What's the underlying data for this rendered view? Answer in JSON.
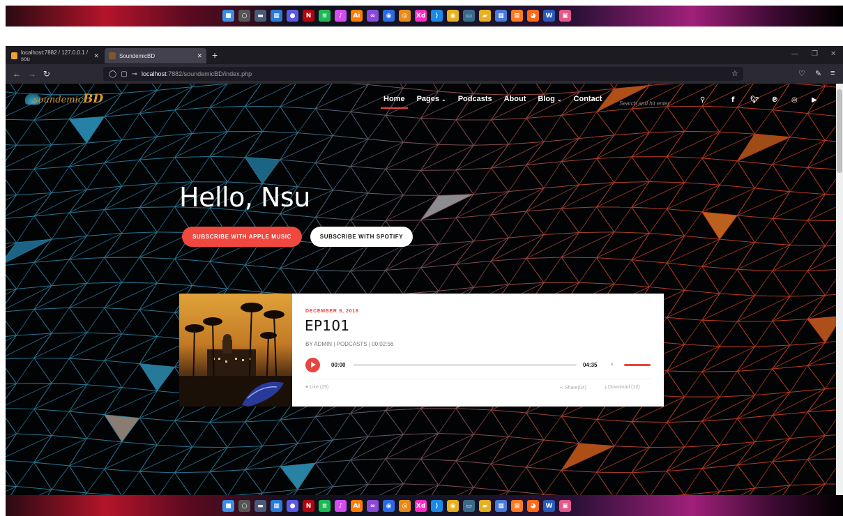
{
  "taskbar": {
    "icons": [
      {
        "name": "windows-start-icon",
        "glyph": "■",
        "color": "#3a8ee6"
      },
      {
        "name": "search-icon",
        "glyph": "○",
        "color": "#555555"
      },
      {
        "name": "task-view-icon",
        "glyph": "▬",
        "color": "#4a5a7a"
      },
      {
        "name": "widgets-icon",
        "glyph": "▦",
        "color": "#2a7ad8"
      },
      {
        "name": "chat-icon",
        "glyph": "●",
        "color": "#5a5ae6"
      },
      {
        "name": "netflix-icon",
        "glyph": "N",
        "color": "#b0060f"
      },
      {
        "name": "spotify-icon",
        "glyph": "≡",
        "color": "#1db954"
      },
      {
        "name": "itunes-icon",
        "glyph": "♪",
        "color": "#d24cf0"
      },
      {
        "name": "illustrator-icon",
        "glyph": "Ai",
        "color": "#ff7c00"
      },
      {
        "name": "visual-studio-icon",
        "glyph": "∞",
        "color": "#8a4ad8"
      },
      {
        "name": "app-icon",
        "glyph": "◉",
        "color": "#2a6ae6"
      },
      {
        "name": "blender-icon",
        "glyph": "◎",
        "color": "#e88a1a"
      },
      {
        "name": "xd-icon",
        "glyph": "Xd",
        "color": "#ff2bc2"
      },
      {
        "name": "vscode-icon",
        "glyph": "⟩",
        "color": "#1a8ae6"
      },
      {
        "name": "chrome-icon",
        "glyph": "◉",
        "color": "#e6b020"
      },
      {
        "name": "terminal-icon",
        "glyph": "▭",
        "color": "#3a6a8a"
      },
      {
        "name": "file-explorer-icon",
        "glyph": "▰",
        "color": "#e6b020"
      },
      {
        "name": "calculator-icon",
        "glyph": "▦",
        "color": "#4a7ad8"
      },
      {
        "name": "xampp-icon",
        "glyph": "⊠",
        "color": "#fb7a24"
      },
      {
        "name": "firefox-icon",
        "glyph": "◕",
        "color": "#ff6a1a"
      },
      {
        "name": "word-icon",
        "glyph": "W",
        "color": "#2a5ab8"
      },
      {
        "name": "photos-icon",
        "glyph": "▣",
        "color": "#e05a8a"
      }
    ]
  },
  "browser": {
    "tabs": [
      {
        "title": "localhost:7882 / 127.0.0.1 / sou",
        "active": false
      },
      {
        "title": "SoundemicBD",
        "active": true
      }
    ],
    "new_tab": "+",
    "url_host": "localhost",
    "url_rest": ":7882/soundemicBD/index.php"
  },
  "site": {
    "logo_text": "soundemic",
    "logo_big": "BD",
    "nav": [
      {
        "label": "Home",
        "active": true,
        "dropdown": false
      },
      {
        "label": "Pages",
        "active": false,
        "dropdown": true
      },
      {
        "label": "Podcasts",
        "active": false,
        "dropdown": false
      },
      {
        "label": "About",
        "active": false,
        "dropdown": false
      },
      {
        "label": "Blog",
        "active": false,
        "dropdown": true
      },
      {
        "label": "Contact",
        "active": false,
        "dropdown": false
      }
    ],
    "search_placeholder": "Search and hit enter...",
    "social_icons": [
      "facebook-icon",
      "twitter-icon",
      "pinterest-icon",
      "instagram-icon",
      "youtube-icon"
    ]
  },
  "hero": {
    "title": "Hello, Nsu",
    "apple_button": "SUBSCRIBE WITH APPLE MUSIC",
    "spotify_button": "SUBSCRIBE WITH SPOTIFY"
  },
  "episode": {
    "date": "DECEMBER 9, 2018",
    "title": "EP101",
    "meta": "BY ADMIN | PODCASTS | 00:02:56",
    "current_time": "00:00",
    "total_time": "04:35",
    "like": "Like (29)",
    "share": "Share(04)",
    "download": "Download (12)"
  },
  "colors": {
    "accent": "#e7453f",
    "page_bg": "#020305"
  }
}
